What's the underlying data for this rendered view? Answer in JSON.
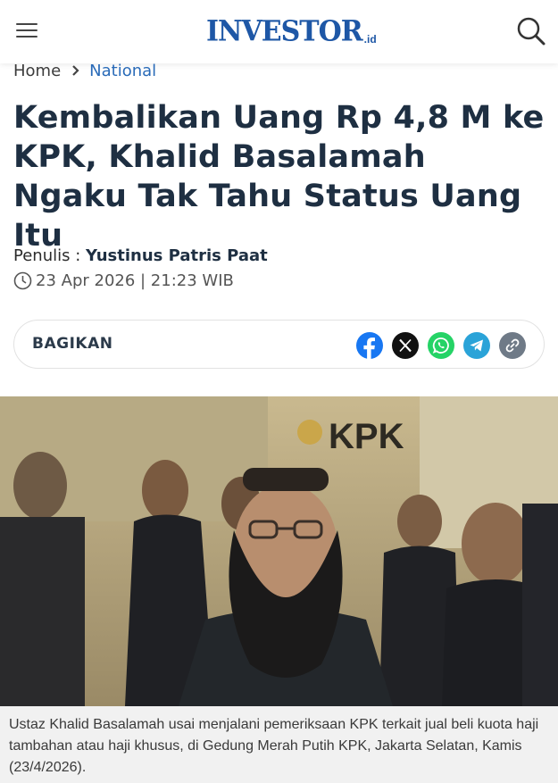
{
  "header": {
    "logo_main": "INVESTOR",
    "logo_suffix": ".id"
  },
  "breadcrumb": {
    "home": "Home",
    "section": "National"
  },
  "article": {
    "title": "Kembalikan Uang Rp 4,8 M ke KPK, Khalid Basalamah Ngaku Tak Tahu Status Uang Itu",
    "author_label": "Penulis : ",
    "author": "Yustinus Patris Paat",
    "datetime": "23 Apr 2026 | 21:23 WIB"
  },
  "share": {
    "label": "BAGIKAN",
    "icons": [
      "facebook-icon",
      "x-icon",
      "whatsapp-icon",
      "telegram-icon",
      "link-icon"
    ]
  },
  "photo": {
    "sign_text": "KPK"
  },
  "caption": "Ustaz Khalid Basalamah usai menjalani pemeriksaan KPK terkait jual beli kuota haji tambahan atau haji khusus, di Gedung Merah Putih KPK, Jakarta Selatan, Kamis (23/4/2026).",
  "colors": {
    "brand": "#1e57a6",
    "link": "#2a6bb8",
    "facebook": "#1877f2",
    "whatsapp": "#25d366",
    "telegram": "#2aa3d8"
  }
}
